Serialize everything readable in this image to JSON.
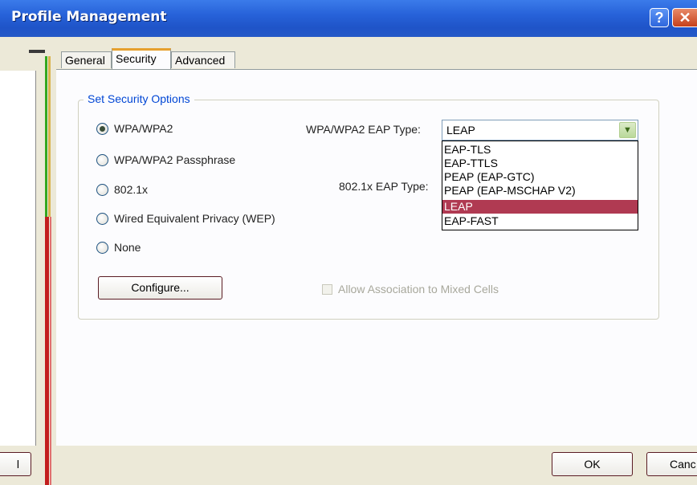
{
  "window": {
    "title": "Profile Management",
    "help_label": "?",
    "close_label": "✕"
  },
  "tabs": {
    "general": "General",
    "security": "Security",
    "advanced": "Advanced"
  },
  "group": {
    "label": "Set Security Options"
  },
  "radios": [
    {
      "label": "WPA/WPA2",
      "selected": true
    },
    {
      "label": "WPA/WPA2 Passphrase",
      "selected": false
    },
    {
      "label": "802.1x",
      "selected": false
    },
    {
      "label": "Wired Equivalent Privacy (WEP)",
      "selected": false
    },
    {
      "label": "None",
      "selected": false
    }
  ],
  "wpa_eap": {
    "label": "WPA/WPA2 EAP Type:",
    "value": "LEAP",
    "options": [
      "EAP-TLS",
      "EAP-TTLS",
      "PEAP (EAP-GTC)",
      "PEAP (EAP-MSCHAP V2)",
      "LEAP",
      "EAP-FAST"
    ],
    "selected_index": 4
  },
  "dot1x_eap": {
    "label": "802.1x EAP Type:"
  },
  "buttons": {
    "configure": "Configure...",
    "ok": "OK",
    "cancel": "Canc",
    "left_cut": "l"
  },
  "mixed_cells": {
    "label": "Allow Association to Mixed Cells",
    "checked": false,
    "enabled": false
  },
  "colors": {
    "title_bar": "#2762D9",
    "group_label": "#0046D5",
    "selection": "#B03A52",
    "accent_tab": "#E6A02E"
  }
}
